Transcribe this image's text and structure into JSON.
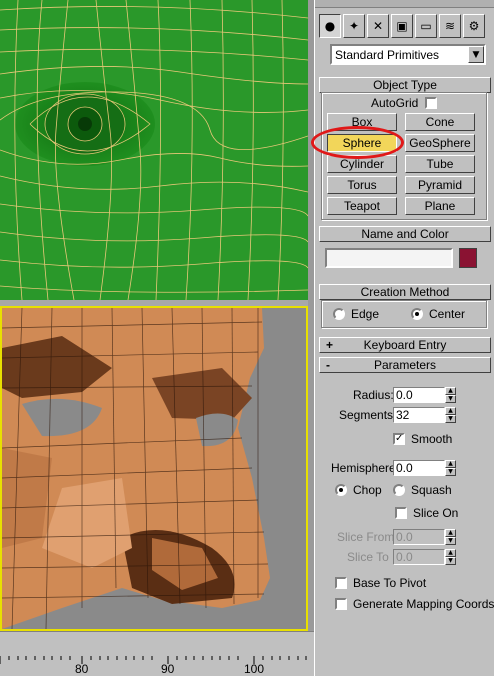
{
  "command_panel": {
    "category_icons": [
      "sphere-icon",
      "light-icon",
      "helper-icon",
      "camera-icon",
      "display-icon",
      "spacewarp-icon",
      "systems-icon"
    ],
    "dropdown": {
      "selected": "Standard Primitives"
    },
    "object_type": {
      "title": "Object Type",
      "autogrid_label": "AutoGrid",
      "buttons": [
        "Box",
        "Cone",
        "Sphere",
        "GeoSphere",
        "Cylinder",
        "Tube",
        "Torus",
        "Pyramid",
        "Teapot",
        "Plane"
      ],
      "selected": "Sphere"
    },
    "name_and_color": {
      "title": "Name and Color",
      "name_value": "",
      "color": "#8a1232"
    },
    "creation_method": {
      "title": "Creation Method",
      "option_edge": "Edge",
      "option_center": "Center",
      "selected": "Center"
    },
    "keyboard_entry": {
      "title": "Keyboard Entry",
      "sign": "+"
    },
    "parameters": {
      "title": "Parameters",
      "sign": "-",
      "radius_label": "Radius:",
      "radius_value": "0.0",
      "segments_label": "Segments:",
      "segments_value": "32",
      "smooth_label": "Smooth",
      "smooth_checked": true,
      "hemisphere_label": "Hemisphere:",
      "hemisphere_value": "0.0",
      "chop_label": "Chop",
      "squash_label": "Squash",
      "chop_selected": true,
      "slice_on_label": "Slice On",
      "slice_from_label": "Slice From",
      "slice_from_value": "0.0",
      "slice_to_label": "Slice To",
      "slice_to_value": "0.0",
      "base_to_pivot_label": "Base To Pivot",
      "gen_mapping_label": "Generate Mapping Coords."
    }
  },
  "time_ruler": {
    "labels": [
      "80",
      "90",
      "100"
    ]
  },
  "colors": {
    "top_viewport": "#1f8f1f",
    "mesh_wire": "#e8c878",
    "persp_border": "#e8e000",
    "highlight": "#e01818",
    "selected_button": "#f2d65a"
  }
}
